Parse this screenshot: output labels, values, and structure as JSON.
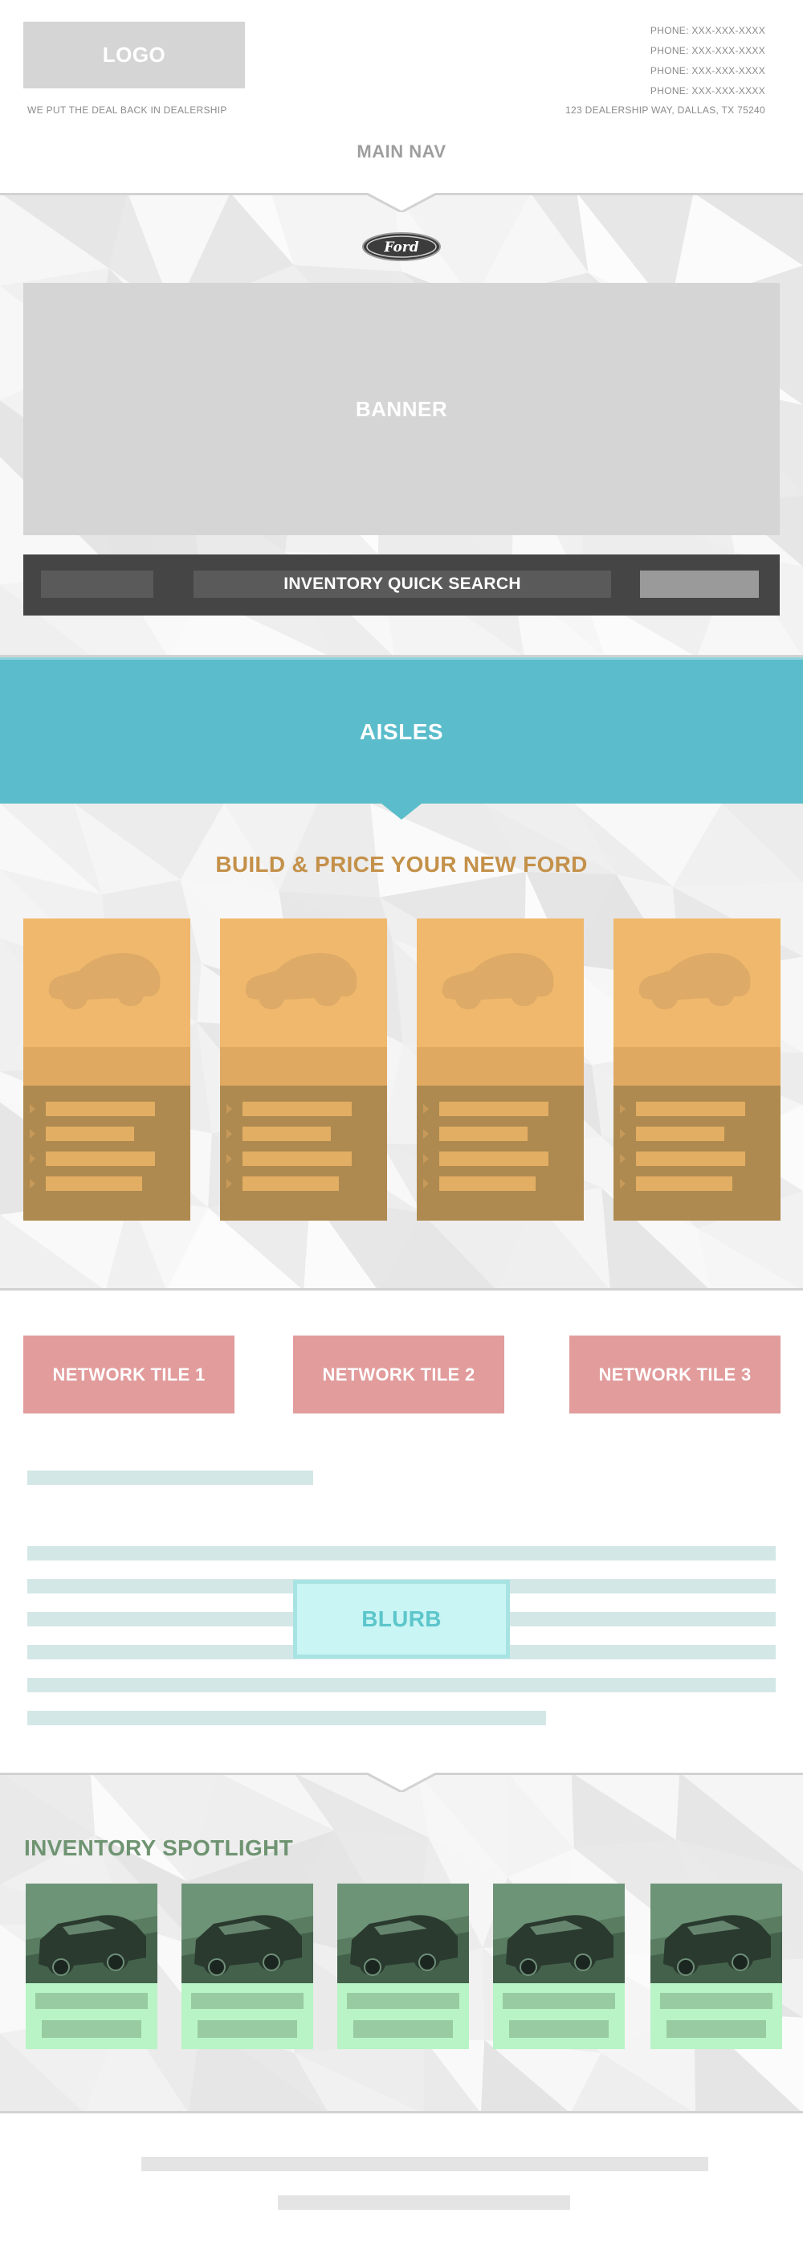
{
  "header": {
    "logo_label": "LOGO",
    "tagline": "WE PUT THE DEAL BACK IN DEALERSHIP",
    "phones": [
      "PHONE: XXX-XXX-XXXX",
      "PHONE: XXX-XXX-XXXX",
      "PHONE: XXX-XXX-XXXX",
      "PHONE: XXX-XXX-XXXX"
    ],
    "address": "123 DEALERSHIP WAY, DALLAS, TX 75240",
    "main_nav": "MAIN NAV"
  },
  "hero": {
    "brand_logo_text": "Ford",
    "banner_label": "BANNER",
    "quick_search_label": "INVENTORY QUICK SEARCH"
  },
  "aisles": {
    "label": "AISLES"
  },
  "build_price": {
    "title": "BUILD & PRICE YOUR NEW FORD",
    "card_count": 4
  },
  "network": {
    "tiles": [
      "NETWORK TILE 1",
      "NETWORK TILE 2",
      "NETWORK TILE 3"
    ],
    "blurb_label": "BLURB"
  },
  "spotlight": {
    "title": "INVENTORY SPOTLIGHT",
    "card_count": 5
  },
  "colors": {
    "aisles_teal": "#5bbdcb",
    "build_title_gold": "#c4914a",
    "card_orange": "#efb86c",
    "card_brown": "#ae8a50",
    "tile_pink": "#e29c9c",
    "blurb_cyan": "#c9f5f5",
    "spotlight_green": "#6f9472",
    "spotlight_card_green": "#b8f4c6"
  },
  "icons": {
    "brand_logo": "ford-oval-logo-icon",
    "card_vehicle": "car-silhouette-icon",
    "list_bullet": "triangle-bullet-icon",
    "spotlight_vehicle": "suv-photo-icon"
  }
}
